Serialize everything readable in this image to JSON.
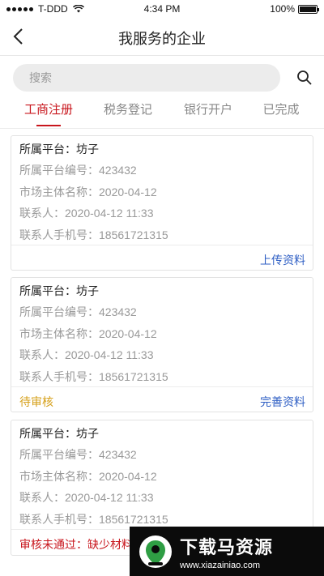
{
  "status_bar": {
    "carrier": "T-DDD",
    "time": "4:34 PM",
    "battery": "100%"
  },
  "header": {
    "title": "我服务的企业"
  },
  "search": {
    "placeholder": "搜索"
  },
  "tabs": [
    {
      "label": "工商注册",
      "active": true
    },
    {
      "label": "税务登记",
      "active": false
    },
    {
      "label": "银行开户",
      "active": false
    },
    {
      "label": "已完成",
      "active": false
    }
  ],
  "cards": [
    {
      "platform": "所属平台：坊子",
      "platform_no": "所属平台编号：423432",
      "entity_name": "市场主体名称：2020-04-12",
      "contact": "联系人：2020-04-12 11:33",
      "phone": "联系人手机号：18561721315",
      "status": "",
      "action": "上传资料"
    },
    {
      "platform": "所属平台：坊子",
      "platform_no": "所属平台编号：423432",
      "entity_name": "市场主体名称：2020-04-12",
      "contact": "联系人：2020-04-12 11:33",
      "phone": "联系人手机号：18561721315",
      "status": "待审核",
      "action": "完善资料"
    },
    {
      "platform": "所属平台：坊子",
      "platform_no": "所属平台编号：423432",
      "entity_name": "市场主体名称：2020-04-12",
      "contact": "联系人：2020-04-12 11:33",
      "phone": "联系人手机号：18561721315",
      "status": "审核未通过：缺少材料",
      "action": ""
    }
  ],
  "watermark": {
    "title": "下载马资源",
    "url": "www.xiazainiao.com"
  },
  "colors": {
    "accent": "#c8161d",
    "link": "#2f5fc4",
    "pending": "#d6a01a"
  }
}
